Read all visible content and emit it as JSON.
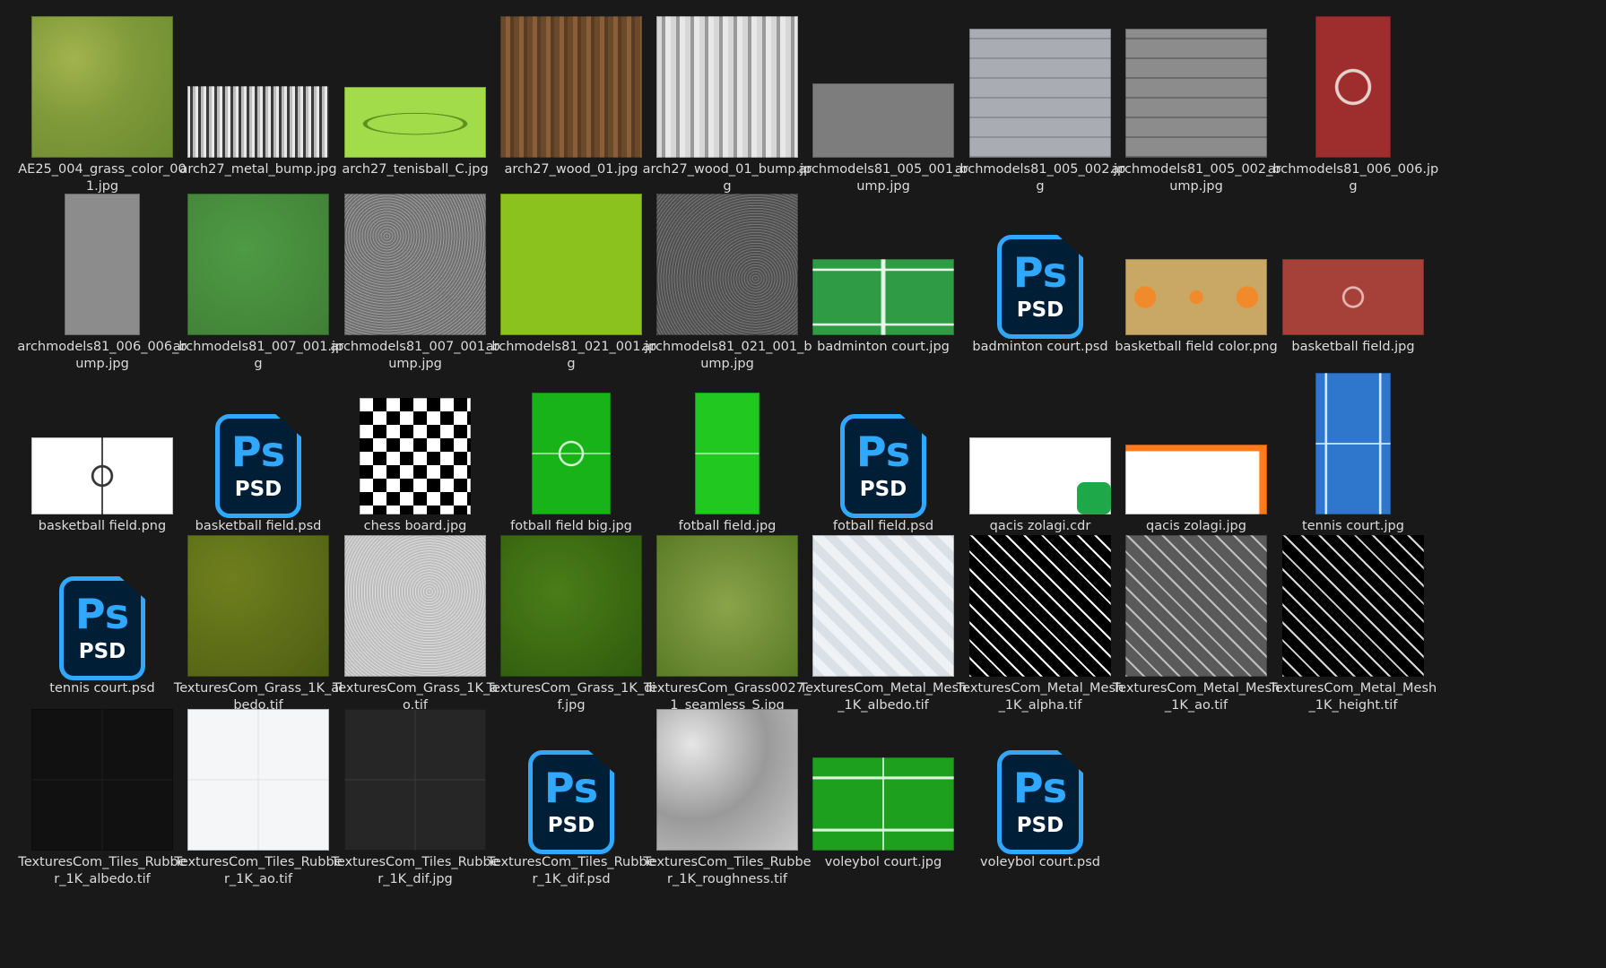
{
  "items": [
    {
      "name": "AE25_004_grass_color_001.jpg",
      "icon": "grass-image-icon",
      "type": "img",
      "w": 158,
      "h": 158,
      "bg": "radial-gradient(circle at 30% 30%, #a3b34d 0%, #7f9a3a 45%, #6b8a2f 100%)"
    },
    {
      "name": "arch27_metal_bump.jpg",
      "icon": "metal-image-icon",
      "type": "img",
      "w": 158,
      "h": 80,
      "bg": "repeating-linear-gradient(90deg,#e9e9e9 0 3px,#3b3b3b 3px 6px,#bdbdbd 6px 9px)"
    },
    {
      "name": "arch27_tenisball_C.jpg",
      "icon": "tennisball-image-icon",
      "type": "img",
      "w": 158,
      "h": 79,
      "bg": "radial-gradient(ellipse 38% 16% at 50% 52%, transparent 88%, #5e8f1f 90%, #5e8f1f 96%, transparent 98%), #a2dc4a"
    },
    {
      "name": "arch27_wood_01.jpg",
      "icon": "wood-image-icon",
      "type": "img",
      "w": 158,
      "h": 158,
      "bg": "repeating-linear-gradient(90deg,#6b4a2b 0 6px,#8a5e38 6px 11px,#5a3c21 11px 15px)"
    },
    {
      "name": "arch27_wood_01_bump.jpg",
      "icon": "wood-bump-image-icon",
      "type": "img",
      "w": 158,
      "h": 158,
      "bg": "repeating-linear-gradient(90deg,#d6d6d6 0 6px,#9a9a9a 6px 10px,#e8e8e8 10px 16px)"
    },
    {
      "name": "archmodels81_005_001_bump.jpg",
      "icon": "concrete-image-icon",
      "type": "img",
      "w": 158,
      "h": 83,
      "bg": "#7d7d7d"
    },
    {
      "name": "archmodels81_005_002.jpg",
      "icon": "paving-image-icon",
      "type": "img",
      "w": 158,
      "h": 144,
      "bg": "repeating-linear-gradient(0deg,#8d9096 0 2px,#a9acb2 2px 22px)"
    },
    {
      "name": "archmodels81_005_002_bump.jpg",
      "icon": "paving-bump-image-icon",
      "type": "img",
      "w": 158,
      "h": 144,
      "bg": "repeating-linear-gradient(0deg,#6a6a6a 0 2px,#8c8c8c 2px 22px)"
    },
    {
      "name": "archmodels81_006_006.jpg",
      "icon": "basketball-court-image-icon",
      "type": "img",
      "w": 84,
      "h": 158,
      "bg": "radial-gradient(circle at 50% 50%, transparent 18%, #e6d2cc 19%, #e6d2cc 22%, transparent 23%), #9e2d2d"
    },
    {
      "name": "archmodels81_006_006_bump.jpg",
      "icon": "concrete-bump-image-icon",
      "type": "img",
      "w": 84,
      "h": 158,
      "bg": "#8c8c8c"
    },
    {
      "name": "archmodels81_007_001.jpg",
      "icon": "turf-image-icon",
      "type": "img",
      "w": 158,
      "h": 158,
      "bg": "radial-gradient(circle at 40% 40%, #4f9a45 0%, #3f7f35 100%)"
    },
    {
      "name": "archmodels81_007_001_bump.jpg",
      "icon": "noise-image-icon",
      "type": "img",
      "w": 158,
      "h": 158,
      "bg": "repeating-radial-gradient(circle at 30% 30%, #9c9c9c 0 1px, #6f6f6f 1px 3px)"
    },
    {
      "name": "archmodels81_021_001.jpg",
      "icon": "green-image-icon",
      "type": "img",
      "w": 158,
      "h": 158,
      "bg": "#8bc21d"
    },
    {
      "name": "archmodels81_021_001_bump.jpg",
      "icon": "noise-dark-image-icon",
      "type": "img",
      "w": 158,
      "h": 158,
      "bg": "repeating-radial-gradient(circle at 70% 60%, #777 0 1px, #4f4f4f 1px 3px)"
    },
    {
      "name": "badminton court.jpg",
      "icon": "badminton-court-image-icon",
      "type": "img",
      "w": 158,
      "h": 85,
      "bg": "linear-gradient(90deg, transparent 48%, #e9f7e9 49%, #e9f7e9 51%, transparent 52%), linear-gradient(0deg, transparent 12%, #e9f7e9 13%, #e9f7e9 15%, transparent 16%, transparent 84%, #e9f7e9 85%, #e9f7e9 87%, transparent 88%), #2f9b45"
    },
    {
      "name": "badminton court.psd",
      "icon": "photoshop-psd-icon",
      "type": "psd"
    },
    {
      "name": "basketball field color.png",
      "icon": "basketball-color-image-icon",
      "type": "img",
      "w": 158,
      "h": 85,
      "bg": "radial-gradient(circle at 50% 50%, #f08a2a 0 8%, transparent 9%), radial-gradient(circle at 14% 50%, #f08a2a 0 8%, transparent 9%), radial-gradient(circle at 86% 50%, #f08a2a 0 8%, transparent 9%), #c9a866"
    },
    {
      "name": "basketball field.jpg",
      "icon": "basketball-field-image-icon",
      "type": "img",
      "w": 158,
      "h": 85,
      "bg": "radial-gradient(circle at 50% 50%, transparent 10%, #e5b7b0 11%, #e5b7b0 13%, transparent 14%), #a6413a"
    },
    {
      "name": "basketball field.png",
      "icon": "basketball-field-outline-image-icon",
      "type": "img",
      "w": 158,
      "h": 86,
      "bg": "radial-gradient(circle at 50% 50%, transparent 10%, #333 11%, #333 13%, transparent 14%), linear-gradient(90deg, transparent 49.3%, #333 49.6%, #333 50.4%, transparent 50.7%), #ffffff"
    },
    {
      "name": "basketball field.psd",
      "icon": "photoshop-psd-icon",
      "type": "psd"
    },
    {
      "name": "chess board.jpg",
      "icon": "chessboard-image-icon",
      "type": "img",
      "w": 124,
      "h": 130,
      "bg": "conic-gradient(#000 0 25%, #fff 0 50%, #000 0 75%, #fff 0) 0 0/30px 30px"
    },
    {
      "name": "fotball field big.jpg",
      "icon": "football-field-big-image-icon",
      "type": "img",
      "w": 88,
      "h": 136,
      "bg": "radial-gradient(circle at 50% 50%, transparent 14%, #d7f7d7 15%, #d7f7d7 17%, transparent 18%), linear-gradient(0deg, transparent 49.4%, #d7f7d7 49.6%, #d7f7d7 50.4%, transparent 50.6%), #18b318"
    },
    {
      "name": "fotball field.jpg",
      "icon": "football-field-image-icon",
      "type": "img",
      "w": 72,
      "h": 136,
      "bg": "linear-gradient(0deg, transparent 49.4%, #d7f7d7 49.6%, #d7f7d7 50.4%, transparent 50.6%), #20c820"
    },
    {
      "name": "fotball field.psd",
      "icon": "photoshop-psd-icon",
      "type": "psd"
    },
    {
      "name": "qacis zolagi.cdr",
      "icon": "coreldraw-file-icon",
      "type": "cdr",
      "w": 158,
      "h": 86,
      "bg": "#ffffff"
    },
    {
      "name": "qacis zolagi.jpg",
      "icon": "stripe-image-icon",
      "type": "img",
      "w": 158,
      "h": 78,
      "bg": "linear-gradient(0deg, transparent 90%, #ff7a1a 91%), linear-gradient(90deg, transparent 94%, #ff7a1a 95%), #ffffff"
    },
    {
      "name": "tennis court.jpg",
      "icon": "tennis-court-image-icon",
      "type": "img",
      "w": 84,
      "h": 158,
      "bg": "linear-gradient(0deg, transparent 49.4%, #d9ecff 49.6%, #d9ecff 50.4%, transparent 50.6%), linear-gradient(90deg, transparent 12%, #d9ecff 13%, #d9ecff 15%, transparent 16%, transparent 84%, #d9ecff 85%, #d9ecff 87%, transparent 88%), #2f77cc"
    },
    {
      "name": "tennis court.psd",
      "icon": "photoshop-psd-icon",
      "type": "psd"
    },
    {
      "name": "TexturesCom_Grass_1K_albedo.tif",
      "icon": "grass-albedo-image-icon",
      "type": "img",
      "w": 158,
      "h": 158,
      "bg": "radial-gradient(circle at 30% 30%, #6f7f1e 0%, #4e5e12 100%)"
    },
    {
      "name": "TexturesCom_Grass_1K_ao.tif",
      "icon": "grass-ao-image-icon",
      "type": "img",
      "w": 158,
      "h": 158,
      "bg": "repeating-radial-gradient(circle at 60% 40%, #dcdcdc 0 1px, #bdbdbd 1px 3px)"
    },
    {
      "name": "TexturesCom_Grass_1K_dif.jpg",
      "icon": "grass-dif-image-icon",
      "type": "img",
      "w": 158,
      "h": 158,
      "bg": "radial-gradient(circle at 40% 40%, #4b7d18 0%, #2f5a0d 100%)"
    },
    {
      "name": "TexturesCom_Grass0027_1_seamless_S.jpg",
      "icon": "grass-seamless-image-icon",
      "type": "img",
      "w": 158,
      "h": 158,
      "bg": "radial-gradient(circle at 50% 50%, #8aa44a 0%, #5a7a25 100%)"
    },
    {
      "name": "TexturesCom_Metal_Mesh_1K_albedo.tif",
      "icon": "metal-mesh-albedo-image-icon",
      "type": "img",
      "w": 158,
      "h": 158,
      "bg": "repeating-linear-gradient(45deg, #d9e0e6 0 10px, #eef2f5 10px 20px), #e8eef2"
    },
    {
      "name": "TexturesCom_Metal_Mesh_1K_alpha.tif",
      "icon": "metal-mesh-alpha-image-icon",
      "type": "img",
      "w": 158,
      "h": 158,
      "bg": "repeating-linear-gradient(45deg, #ffffff 0 2px, #000 2px 14px), repeating-linear-gradient(-45deg, #ffffff 0 2px, #000 2px 14px)"
    },
    {
      "name": "TexturesCom_Metal_Mesh_1K_ao.tif",
      "icon": "metal-mesh-ao-image-icon",
      "type": "img",
      "w": 158,
      "h": 158,
      "bg": "repeating-linear-gradient(45deg, #c0c0c0 0 2px, #5a5a5a 2px 14px), repeating-linear-gradient(-45deg, #c0c0c0 0 2px, #5a5a5a 2px 14px)"
    },
    {
      "name": "TexturesCom_Metal_Mesh_1K_height.tif",
      "icon": "metal-mesh-height-image-icon",
      "type": "img",
      "w": 158,
      "h": 158,
      "bg": "repeating-linear-gradient(45deg, #d9d9d9 0 2px, #000 2px 14px), repeating-linear-gradient(-45deg, #d9d9d9 0 2px, #000 2px 14px)"
    },
    {
      "name": "TexturesCom_Tiles_Rubber_1K_albedo.tif",
      "icon": "rubber-tiles-albedo-image-icon",
      "type": "img",
      "w": 158,
      "h": 158,
      "bg": "linear-gradient(90deg, transparent 49.6%, #1e1e1e 49.8%, #1e1e1e 50.2%, transparent 50.4%), linear-gradient(0deg, transparent 49.6%, #1e1e1e 49.8%, #1e1e1e 50.2%, transparent 50.4%), #111111"
    },
    {
      "name": "TexturesCom_Tiles_Rubber_1K_ao.tif",
      "icon": "rubber-tiles-ao-image-icon",
      "type": "img",
      "w": 158,
      "h": 158,
      "bg": "linear-gradient(90deg, transparent 49.6%, #e3e3e3 49.8%, #e3e3e3 50.2%, transparent 50.4%), linear-gradient(0deg, transparent 49.6%, #e3e3e3 49.8%, #e3e3e3 50.2%, transparent 50.4%), #f5f6f7"
    },
    {
      "name": "TexturesCom_Tiles_Rubber_1K_dif.jpg",
      "icon": "rubber-tiles-dif-image-icon",
      "type": "img",
      "w": 158,
      "h": 158,
      "bg": "linear-gradient(90deg, transparent 49.6%, #3a3a3a 49.8%, #3a3a3a 50.2%, transparent 50.4%), linear-gradient(0deg, transparent 49.6%, #3a3a3a 49.8%, #3a3a3a 50.2%, transparent 50.4%), #262626"
    },
    {
      "name": "TexturesCom_Tiles_Rubber_1K_dif.psd",
      "icon": "photoshop-psd-icon",
      "type": "psd"
    },
    {
      "name": "TexturesCom_Tiles_Rubber_1K_roughness.tif",
      "icon": "rubber-tiles-roughness-image-icon",
      "type": "img",
      "w": 158,
      "h": 158,
      "bg": "radial-gradient(circle at 25% 25%, #e6e6e6 0%, #9a9a9a 50%, #c9c9c9 100%)"
    },
    {
      "name": "voleybol court.jpg",
      "icon": "volleyball-court-image-icon",
      "type": "img",
      "w": 158,
      "h": 104,
      "bg": "linear-gradient(90deg, transparent 49.4%, #d9f7d9 49.6%, #d9f7d9 50.4%, transparent 50.6%), linear-gradient(0deg, transparent 20%, #d9f7d9 21%, #d9f7d9 23%, transparent 24%, transparent 76%, #d9f7d9 77%, #d9f7d9 79%, transparent 80%), #1da01d"
    },
    {
      "name": "voleybol court.psd",
      "icon": "photoshop-psd-icon",
      "type": "psd"
    }
  ],
  "psd_icon": {
    "ps": "Ps",
    "psd": "PSD"
  }
}
